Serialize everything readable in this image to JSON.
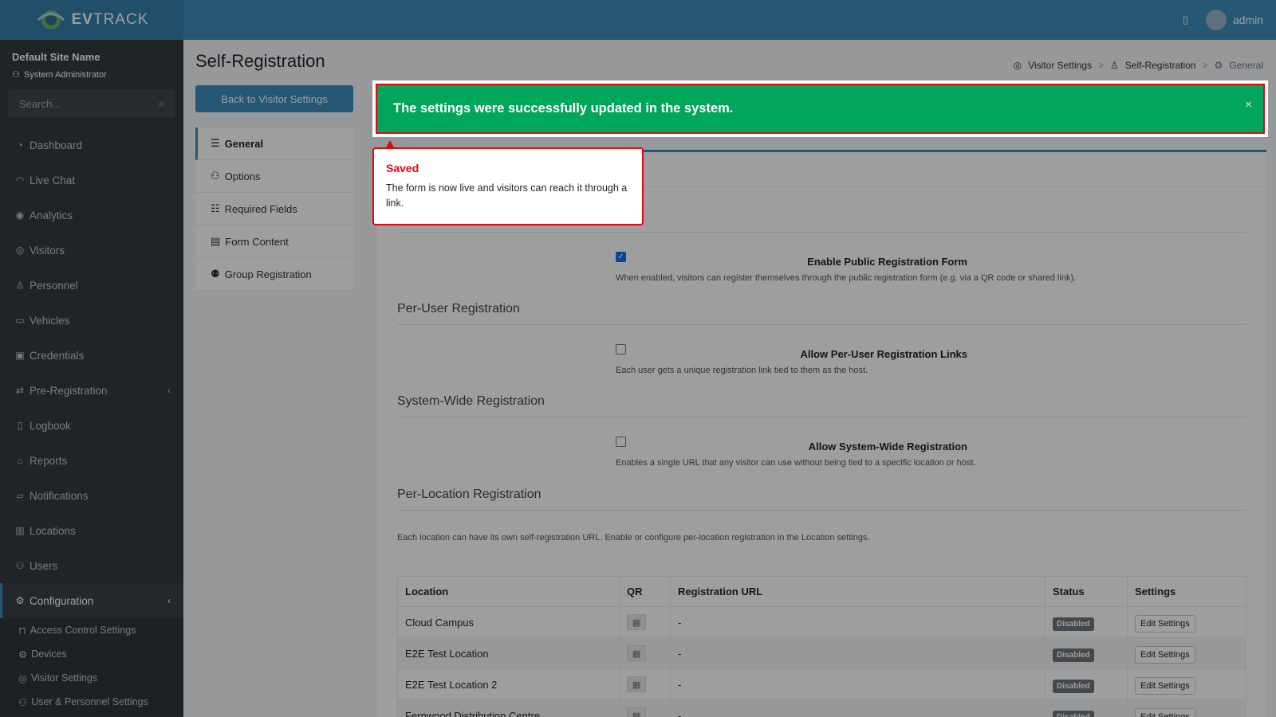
{
  "topbar": {
    "logo_bold": "EV",
    "logo_light": "TRACK",
    "user": "admin"
  },
  "sidebar": {
    "site_name": "Default Site Name",
    "role": "System Administrator",
    "search_placeholder": "Search...",
    "items": [
      {
        "label": "Dashboard",
        "icon": "dashboard-icon"
      },
      {
        "label": "Live Chat",
        "icon": "headset-icon"
      },
      {
        "label": "Analytics",
        "icon": "target-icon"
      },
      {
        "label": "Visitors",
        "icon": "eye-icon"
      },
      {
        "label": "Personnel",
        "icon": "user-tie-icon"
      },
      {
        "label": "Vehicles",
        "icon": "car-icon"
      },
      {
        "label": "Credentials",
        "icon": "id-card-icon"
      },
      {
        "label": "Pre-Registration",
        "icon": "arrows-icon"
      },
      {
        "label": "Logbook",
        "icon": "book-icon"
      },
      {
        "label": "Reports",
        "icon": "chart-icon"
      },
      {
        "label": "Notifications",
        "icon": "bell-icon"
      },
      {
        "label": "Locations",
        "icon": "building-icon"
      },
      {
        "label": "Users",
        "icon": "users-icon"
      },
      {
        "label": "Configuration",
        "icon": "gear-icon"
      }
    ],
    "submenu": [
      {
        "label": "Access Control Settings",
        "icon": "lock-icon"
      },
      {
        "label": "Devices",
        "icon": "gear-icon"
      },
      {
        "label": "Visitor Settings",
        "icon": "eye-icon"
      },
      {
        "label": "User & Personnel Settings",
        "icon": "users-icon"
      }
    ]
  },
  "page": {
    "title": "Self-Registration",
    "breadcrumb": [
      "Visitor Settings",
      "Self-Registration",
      "General"
    ],
    "back_button": "Back to Visitor Settings",
    "subnav": [
      "General",
      "Options",
      "Required Fields",
      "Form Content",
      "Group Registration"
    ]
  },
  "toast": {
    "message": "The settings were successfully updated in the system.",
    "close": "×"
  },
  "callout": {
    "title": "Saved",
    "body": "The form is now live and visitors can reach it through a link."
  },
  "form": {
    "enable_public_label": "Enable Public Registration Form",
    "enable_public_checked": true,
    "enable_public_help": "When enabled, visitors can register themselves through the public registration form (e.g. via a QR code or shared link).",
    "per_user_title": "Per-User Registration",
    "per_user_label": "Allow Per-User Registration Links",
    "per_user_help": "Each user gets a unique registration link tied to them as the host.",
    "system_wide_title": "System-Wide Registration",
    "system_wide_label": "Allow System-Wide Registration",
    "system_wide_help": "Enables a single URL that any visitor can use without being tied to a specific location or host.",
    "per_location_title": "Per-Location Registration",
    "per_location_text": "Each location can have its own self-registration URL. Enable or configure per-location registration in the Location settings."
  },
  "table": {
    "headers": [
      "Location",
      "QR",
      "Registration URL",
      "Status",
      "Settings"
    ],
    "rows": [
      {
        "location": "Cloud Campus",
        "url": "-",
        "status": "Disabled",
        "action": "Edit Settings"
      },
      {
        "location": "E2E Test Location",
        "url": "-",
        "status": "Disabled",
        "action": "Edit Settings"
      },
      {
        "location": "E2E Test Location 2",
        "url": "-",
        "status": "Disabled",
        "action": "Edit Settings"
      },
      {
        "location": "Fernwood Distribution Centre",
        "url": "-",
        "status": "Disabled",
        "action": "Edit Settings"
      }
    ]
  }
}
